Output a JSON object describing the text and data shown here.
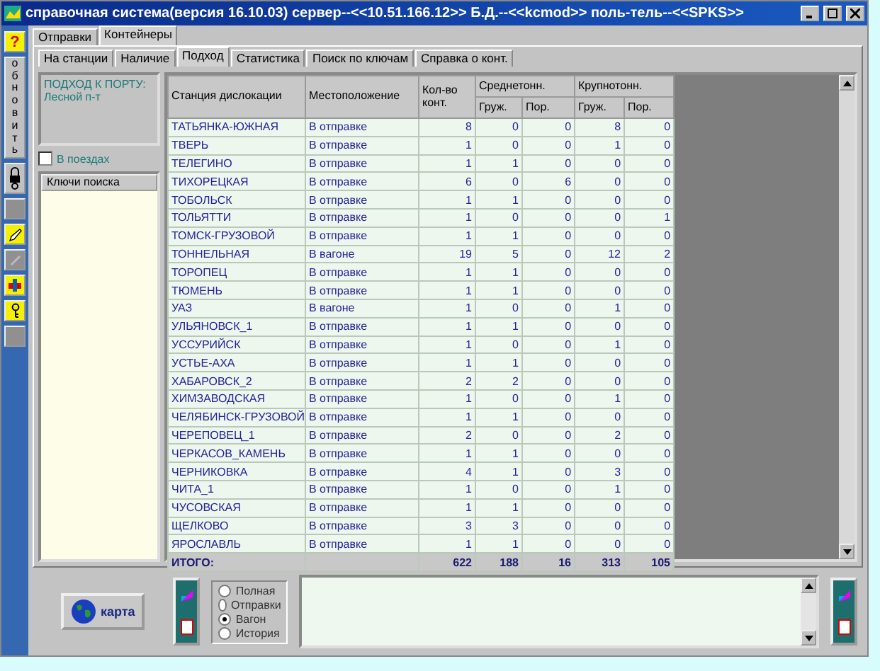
{
  "window": {
    "title": "справочная система(версия 16.10.03) сервер--<<10.51.166.12>> Б.Д.--<<kcmod>> поль-тель--<<SPKS>>"
  },
  "toolbar": {
    "help": "?",
    "refresh": "обновить"
  },
  "tabs": [
    {
      "label": "Отправки",
      "selected": false
    },
    {
      "label": "Контейнеры",
      "selected": true
    }
  ],
  "subtabs": [
    {
      "label": "На станции",
      "selected": false
    },
    {
      "label": "Наличие",
      "selected": false
    },
    {
      "label": "Подход",
      "selected": true
    },
    {
      "label": "Статистика",
      "selected": false
    },
    {
      "label": "Поиск по ключам",
      "selected": false
    },
    {
      "label": "Справка о конт.",
      "selected": false
    }
  ],
  "info": {
    "title": "ПОДХОД К ПОРТУ:",
    "subtitle": "Лесной п-т"
  },
  "trains_checkbox": {
    "label": "В поездах",
    "checked": false
  },
  "keys_list": {
    "header": "Ключи поиска"
  },
  "table": {
    "columns": {
      "station": "Станция дислокации",
      "location": "Местоположение",
      "count": "Кол-во конт.",
      "groups": [
        {
          "label": "Среднетонн.",
          "sub": [
            "Груж.",
            "Пор."
          ]
        },
        {
          "label": "Крупнотонн.",
          "sub": [
            "Груж.",
            "Пор."
          ]
        }
      ]
    },
    "rows": [
      [
        "ТАТЬЯНКА-ЮЖНАЯ",
        "В отправке",
        "8",
        "0",
        "0",
        "8",
        "0"
      ],
      [
        "ТВЕРЬ",
        "В отправке",
        "1",
        "0",
        "0",
        "1",
        "0"
      ],
      [
        "ТЕЛЕГИНО",
        "В отправке",
        "1",
        "1",
        "0",
        "0",
        "0"
      ],
      [
        "ТИХОРЕЦКАЯ",
        "В отправке",
        "6",
        "0",
        "6",
        "0",
        "0"
      ],
      [
        "ТОБОЛЬСК",
        "В отправке",
        "1",
        "1",
        "0",
        "0",
        "0"
      ],
      [
        "ТОЛЬЯТТИ",
        "В отправке",
        "1",
        "0",
        "0",
        "0",
        "1"
      ],
      [
        "ТОМСК-ГРУЗОВОЙ",
        "В отправке",
        "1",
        "1",
        "0",
        "0",
        "0"
      ],
      [
        "ТОННЕЛЬНАЯ",
        "В вагоне",
        "19",
        "5",
        "0",
        "12",
        "2"
      ],
      [
        "ТОРОПЕЦ",
        "В отправке",
        "1",
        "1",
        "0",
        "0",
        "0"
      ],
      [
        "ТЮМЕНЬ",
        "В отправке",
        "1",
        "1",
        "0",
        "0",
        "0"
      ],
      [
        "УАЗ",
        "В вагоне",
        "1",
        "0",
        "0",
        "1",
        "0"
      ],
      [
        "УЛЬЯНОВСК_1",
        "В отправке",
        "1",
        "1",
        "0",
        "0",
        "0"
      ],
      [
        "УССУРИЙСК",
        "В отправке",
        "1",
        "0",
        "0",
        "1",
        "0"
      ],
      [
        "УСТЬЕ-АХА",
        "В отправке",
        "1",
        "1",
        "0",
        "0",
        "0"
      ],
      [
        "ХАБАРОВСК_2",
        "В отправке",
        "2",
        "2",
        "0",
        "0",
        "0"
      ],
      [
        "ХИМЗАВОДСКАЯ",
        "В отправке",
        "1",
        "0",
        "0",
        "1",
        "0"
      ],
      [
        "ЧЕЛЯБИНСК-ГРУЗОВОЙ",
        "В отправке",
        "1",
        "1",
        "0",
        "0",
        "0"
      ],
      [
        "ЧЕРЕПОВЕЦ_1",
        "В отправке",
        "2",
        "0",
        "0",
        "2",
        "0"
      ],
      [
        "ЧЕРКАСОВ_КАМЕНЬ",
        "В отправке",
        "1",
        "1",
        "0",
        "0",
        "0"
      ],
      [
        "ЧЕРНИКОВКА",
        "В отправке",
        "4",
        "1",
        "0",
        "3",
        "0"
      ],
      [
        "ЧИТА_1",
        "В отправке",
        "1",
        "0",
        "0",
        "1",
        "0"
      ],
      [
        "ЧУСОВСКАЯ",
        "В отправке",
        "1",
        "1",
        "0",
        "0",
        "0"
      ],
      [
        "ЩЕЛКОВО",
        "В отправке",
        "3",
        "3",
        "0",
        "0",
        "0"
      ],
      [
        "ЯРОСЛАВЛЬ",
        "В отправке",
        "1",
        "1",
        "0",
        "0",
        "0"
      ]
    ],
    "total": {
      "label": "ИТОГО:",
      "values": [
        "622",
        "188",
        "16",
        "313",
        "105"
      ]
    }
  },
  "map_button": {
    "label": "карта"
  },
  "modes": [
    {
      "label": "Полная",
      "selected": false
    },
    {
      "label": "Отправки",
      "selected": false
    },
    {
      "label": "Вагон",
      "selected": true
    },
    {
      "label": "История",
      "selected": false
    }
  ]
}
